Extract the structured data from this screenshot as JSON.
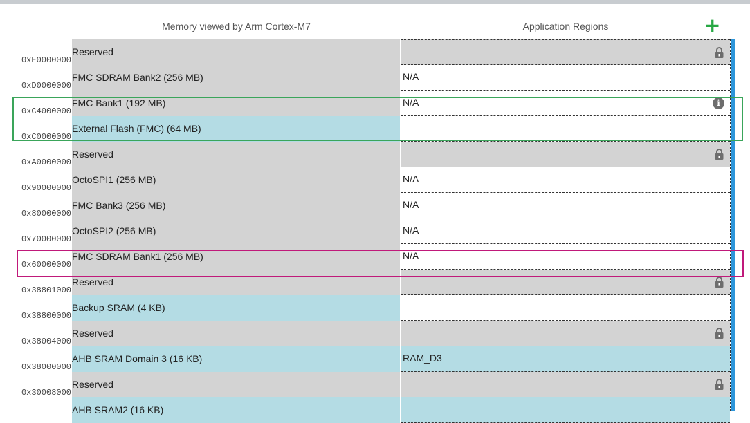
{
  "headers": {
    "memory_view": "Memory viewed by Arm Cortex-M7",
    "application_regions": "Application Regions",
    "add_button": "+"
  },
  "icons": {
    "lock": "lock-icon",
    "info": "info-icon",
    "add": "plus-icon"
  },
  "colors": {
    "system_region": "#d3d3d3",
    "external_region": "#b4dce4",
    "add_button": "#27a844",
    "scrollbar": "#2e96da",
    "highlight_green": "#3aa55a",
    "highlight_magenta": "#c0197a"
  },
  "rows": [
    {
      "address": "0xE0000000",
      "region": "Reserved",
      "app": "",
      "kind": "sys",
      "app_state": "locked",
      "icon": "lock"
    },
    {
      "address": "0xD0000000",
      "region": "FMC SDRAM Bank2 (256 MB)",
      "app": "N/A",
      "kind": "sys",
      "app_state": "white",
      "icon": ""
    },
    {
      "address": "0xC4000000",
      "region": "FMC Bank1 (192 MB)",
      "app": "N/A",
      "kind": "sys",
      "app_state": "white",
      "icon": "info"
    },
    {
      "address": "0xC0000000",
      "region": "External Flash (FMC) (64 MB)",
      "app": "",
      "kind": "ext",
      "app_state": "white",
      "icon": ""
    },
    {
      "address": "0xA0000000",
      "region": "Reserved",
      "app": "",
      "kind": "sys",
      "app_state": "locked",
      "icon": "lock"
    },
    {
      "address": "0x90000000",
      "region": "OctoSPI1 (256 MB)",
      "app": "N/A",
      "kind": "sys",
      "app_state": "white",
      "icon": ""
    },
    {
      "address": "0x80000000",
      "region": "FMC Bank3 (256 MB)",
      "app": "N/A",
      "kind": "sys",
      "app_state": "white",
      "icon": ""
    },
    {
      "address": "0x70000000",
      "region": "OctoSPI2 (256 MB)",
      "app": "N/A",
      "kind": "sys",
      "app_state": "white",
      "icon": ""
    },
    {
      "address": "0x60000000",
      "region": "FMC SDRAM Bank1 (256 MB)",
      "app": "N/A",
      "kind": "sys",
      "app_state": "white",
      "icon": ""
    },
    {
      "address": "0x38801000",
      "region": "Reserved",
      "app": "",
      "kind": "sys",
      "app_state": "locked",
      "icon": "lock"
    },
    {
      "address": "0x38800000",
      "region": "Backup SRAM (4 KB)",
      "app": "",
      "kind": "ext",
      "app_state": "white",
      "icon": ""
    },
    {
      "address": "0x38004000",
      "region": "Reserved",
      "app": "",
      "kind": "sys",
      "app_state": "locked",
      "icon": "lock"
    },
    {
      "address": "0x38000000",
      "region": "AHB SRAM Domain 3 (16 KB)",
      "app": "RAM_D3",
      "kind": "ext",
      "app_state": "filled",
      "icon": ""
    },
    {
      "address": "0x30008000",
      "region": "Reserved",
      "app": "",
      "kind": "sys",
      "app_state": "locked",
      "icon": "lock"
    },
    {
      "address": "",
      "region": "AHB SRAM2 (16 KB)",
      "app": "",
      "kind": "ext",
      "app_state": "filled",
      "icon": ""
    }
  ]
}
